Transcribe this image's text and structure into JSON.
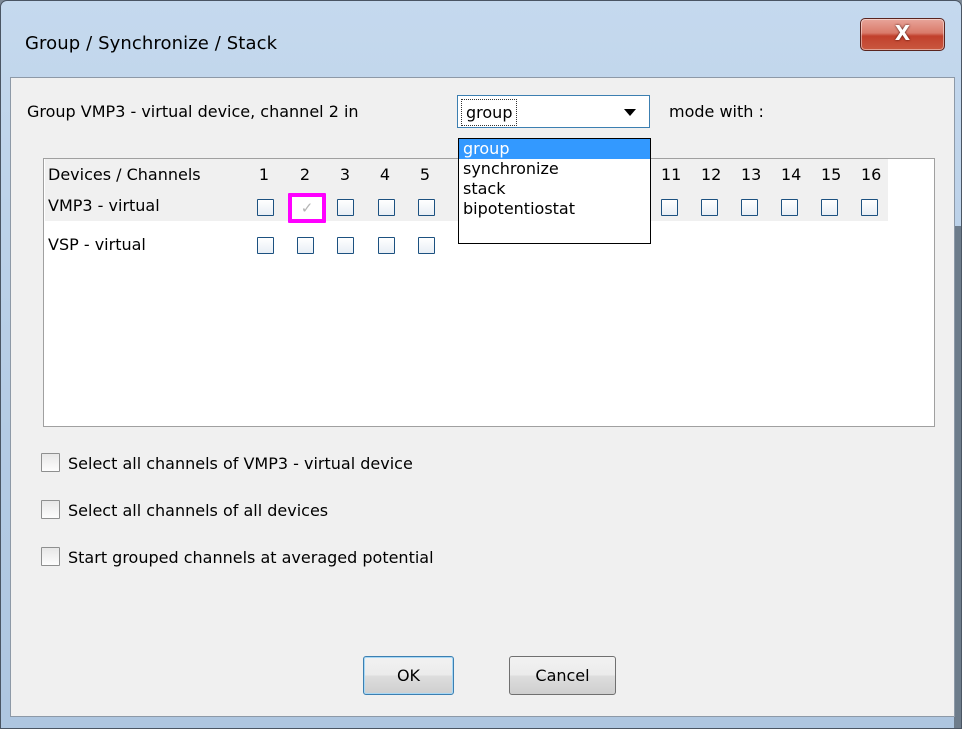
{
  "window": {
    "title": "Group / Synchronize / Stack",
    "close_label": "X"
  },
  "header": {
    "prefix": "Group VMP3 - virtual device, channel 2 in",
    "mode_value": "group",
    "suffix": "mode with :"
  },
  "mode_dropdown": {
    "options": [
      "group",
      "synchronize",
      "stack",
      "bipotentiostat"
    ],
    "selected_index": 0
  },
  "table": {
    "header_label": "Devices / Channels",
    "visible_channels": [
      "1",
      "2",
      "3",
      "4",
      "5",
      "11",
      "12",
      "13",
      "14",
      "15",
      "16"
    ],
    "devices": [
      {
        "name": "VMP3 - virtual",
        "checked_channels": [
          "2"
        ]
      },
      {
        "name": "VSP - virtual",
        "checked_channels": []
      }
    ]
  },
  "options": [
    {
      "label": "Select all channels of VMP3 - virtual device",
      "checked": false
    },
    {
      "label": "Select all channels of all devices",
      "checked": false
    },
    {
      "label": "Start grouped channels at averaged potential",
      "checked": false
    }
  ],
  "buttons": {
    "ok": "OK",
    "cancel": "Cancel"
  },
  "colors": {
    "highlight": "#ff00ff",
    "selection": "#3399ff",
    "close_button": "#c1402c"
  }
}
